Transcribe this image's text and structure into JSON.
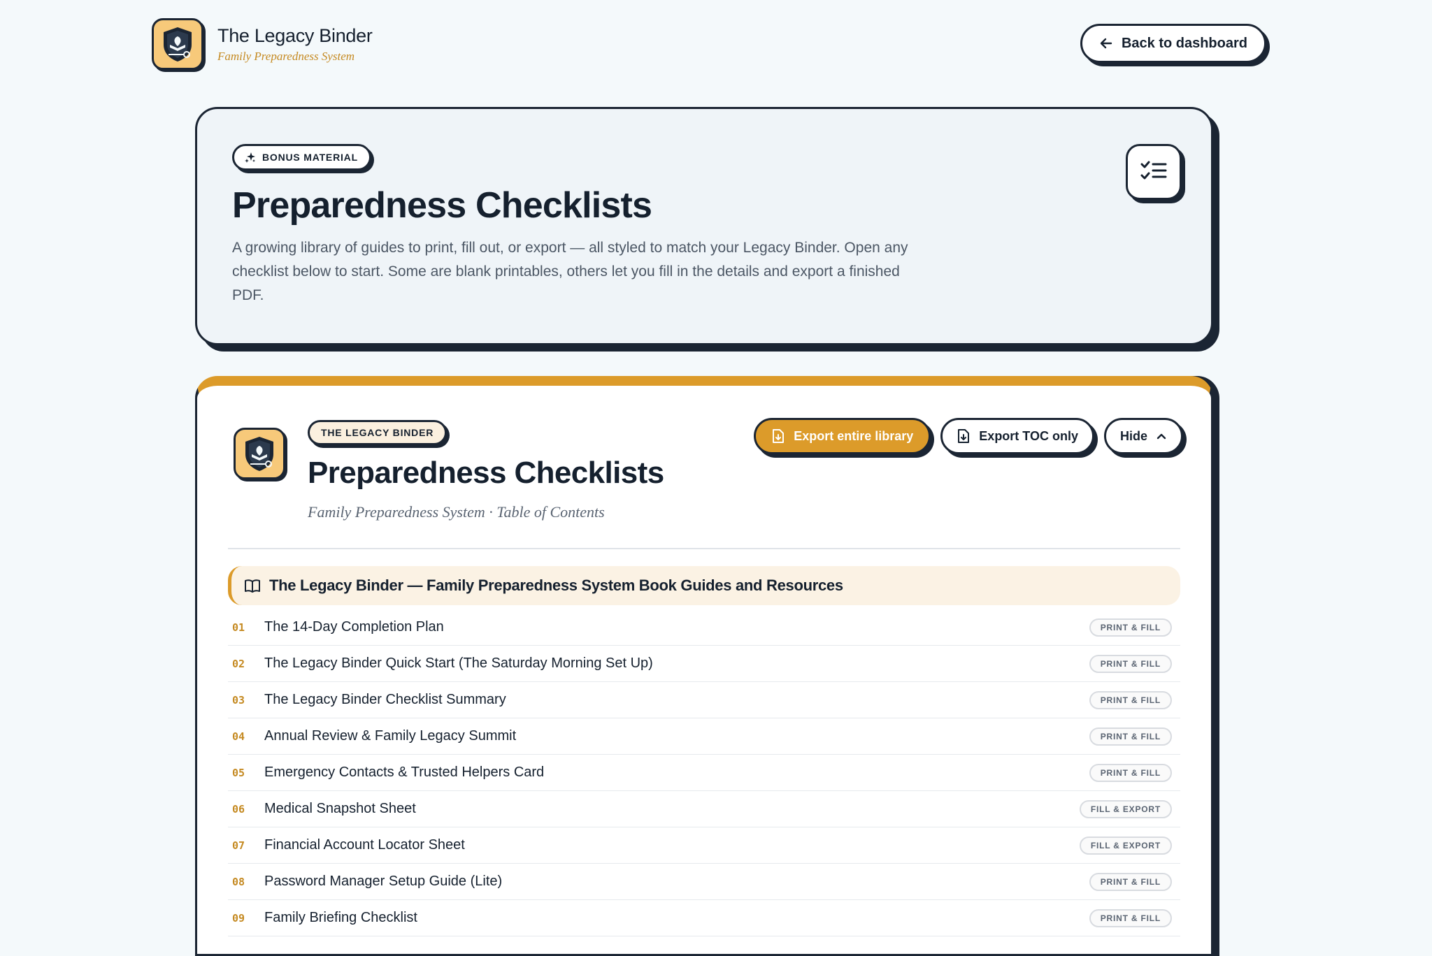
{
  "header": {
    "brand_title": "The Legacy Binder",
    "brand_subtitle": "Family Preparedness System",
    "back_label": "Back to dashboard"
  },
  "hero": {
    "badge": "BONUS MATERIAL",
    "title": "Preparedness Checklists",
    "description": "A growing library of guides to print, fill out, or export — all styled to match your Legacy Binder. Open any checklist below to start. Some are blank printables, others let you fill in the details and export a finished PDF."
  },
  "toc": {
    "badge": "THE LEGACY BINDER",
    "title": "Preparedness Checklists",
    "subtitle": "Family Preparedness System · Table of Contents",
    "export_library_label": "Export entire library",
    "export_toc_label": "Export TOC only",
    "hide_label": "Hide",
    "section_title": "The Legacy Binder — Family Preparedness System Book Guides and Resources",
    "items": [
      {
        "num": "01",
        "title": "The 14-Day Completion Plan",
        "badge": "PRINT & FILL"
      },
      {
        "num": "02",
        "title": "The Legacy Binder Quick Start (The Saturday Morning Set Up)",
        "badge": "PRINT & FILL"
      },
      {
        "num": "03",
        "title": "The Legacy Binder Checklist Summary",
        "badge": "PRINT & FILL"
      },
      {
        "num": "04",
        "title": "Annual Review & Family Legacy Summit",
        "badge": "PRINT & FILL"
      },
      {
        "num": "05",
        "title": "Emergency Contacts & Trusted Helpers Card",
        "badge": "PRINT & FILL"
      },
      {
        "num": "06",
        "title": "Medical Snapshot Sheet",
        "badge": "FILL & EXPORT"
      },
      {
        "num": "07",
        "title": "Financial Account Locator Sheet",
        "badge": "FILL & EXPORT"
      },
      {
        "num": "08",
        "title": "Password Manager Setup Guide (Lite)",
        "badge": "PRINT & FILL"
      },
      {
        "num": "09",
        "title": "Family Briefing Checklist",
        "badge": "PRINT & FILL"
      }
    ]
  },
  "colors": {
    "accent": "#dc9b2a",
    "ink": "#1b2533",
    "logo_bg": "#f7c97a",
    "page_bg": "#f4f9fb"
  }
}
